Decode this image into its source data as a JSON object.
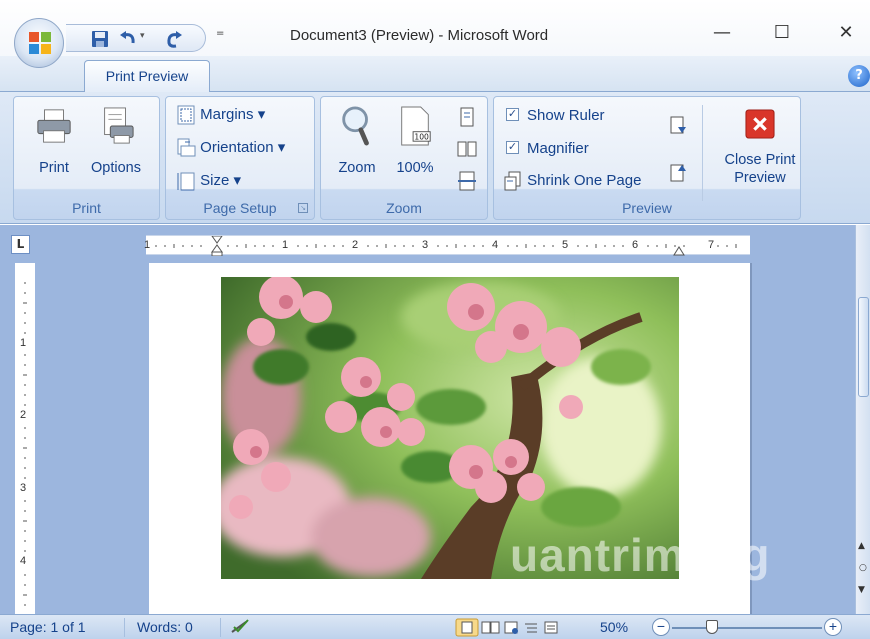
{
  "window": {
    "title": "Document3 (Preview) - Microsoft Word",
    "controls": {
      "minimize": "—",
      "maximize": "☐",
      "close": "✕"
    }
  },
  "quick_access": {
    "items": [
      "save-icon",
      "undo-icon",
      "redo-icon"
    ],
    "customize_glyph": "="
  },
  "tabs": [
    {
      "label": "Print Preview",
      "active": true
    }
  ],
  "help_glyph": "?",
  "ribbon": {
    "groups": [
      {
        "label": "Print",
        "buttons": [
          "Print",
          "Options"
        ]
      },
      {
        "label": "Page Setup",
        "buttons": [
          "Margins ▾",
          "Orientation ▾",
          "Size ▾"
        ],
        "launcher": "↘"
      },
      {
        "label": "Zoom",
        "buttons": [
          "Zoom",
          "100%"
        ]
      },
      {
        "label": "Preview",
        "checkboxes": [
          {
            "label": "Show Ruler",
            "checked": true
          },
          {
            "label": "Magnifier",
            "checked": true
          }
        ],
        "buttons": [
          "Shrink One Page",
          "Close Print",
          "Preview"
        ]
      }
    ],
    "zoom_icon_text": "100"
  },
  "ruler": {
    "corner": "L",
    "h_numbers": [
      "1",
      "1",
      "2",
      "3",
      "4",
      "5",
      "6",
      "7"
    ],
    "v_numbers": [
      "1",
      "2",
      "3",
      "4"
    ]
  },
  "watermark": "uantrimang",
  "statusbar": {
    "page": "Page: 1 of 1",
    "words": "Words: 0",
    "zoom": "50%",
    "zoom_out": "−",
    "zoom_in": "+"
  },
  "colors": {
    "ribbon_text": "#15428b",
    "workspace": "#9cb6de",
    "close_red": "#d9362a"
  }
}
